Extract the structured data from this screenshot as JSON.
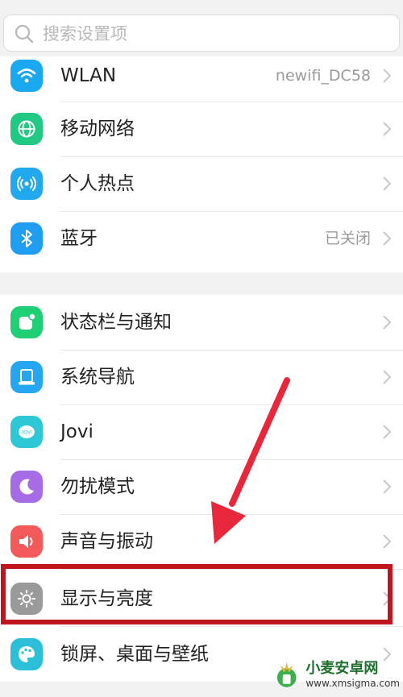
{
  "search": {
    "placeholder": "搜索设置项"
  },
  "group1": [
    {
      "label": "WLAN",
      "value": "newifi_DC58",
      "icon": "wifi-icon",
      "color": "#1aa9f0"
    },
    {
      "label": "移动网络",
      "value": "",
      "icon": "globe-icon",
      "color": "#22c983"
    },
    {
      "label": "个人热点",
      "value": "",
      "icon": "hotspot-icon",
      "color": "#21a8ef"
    },
    {
      "label": "蓝牙",
      "value": "已关闭",
      "icon": "bluetooth-icon",
      "color": "#1f9df0"
    }
  ],
  "group2": [
    {
      "label": "状态栏与通知",
      "value": "",
      "icon": "notification-icon",
      "color": "#1fcf73"
    },
    {
      "label": "系统导航",
      "value": "",
      "icon": "navigation-icon",
      "color": "#25a6f0"
    },
    {
      "label": "Jovi",
      "value": "",
      "icon": "jovi-icon",
      "color": "#2ec7d6"
    },
    {
      "label": "勿扰模式",
      "value": "",
      "icon": "moon-icon",
      "color": "#a66ce6"
    },
    {
      "label": "声音与振动",
      "value": "",
      "icon": "speaker-icon",
      "color": "#f25a5a"
    },
    {
      "label": "显示与亮度",
      "value": "",
      "icon": "brightness-icon",
      "color": "#9a9a9a"
    },
    {
      "label": "锁屏、桌面与壁纸",
      "value": "",
      "icon": "palette-icon",
      "color": "#2bbfd8"
    }
  ],
  "watermark": {
    "title": "小麦安卓网",
    "sub": "www.xmsigma.com"
  }
}
